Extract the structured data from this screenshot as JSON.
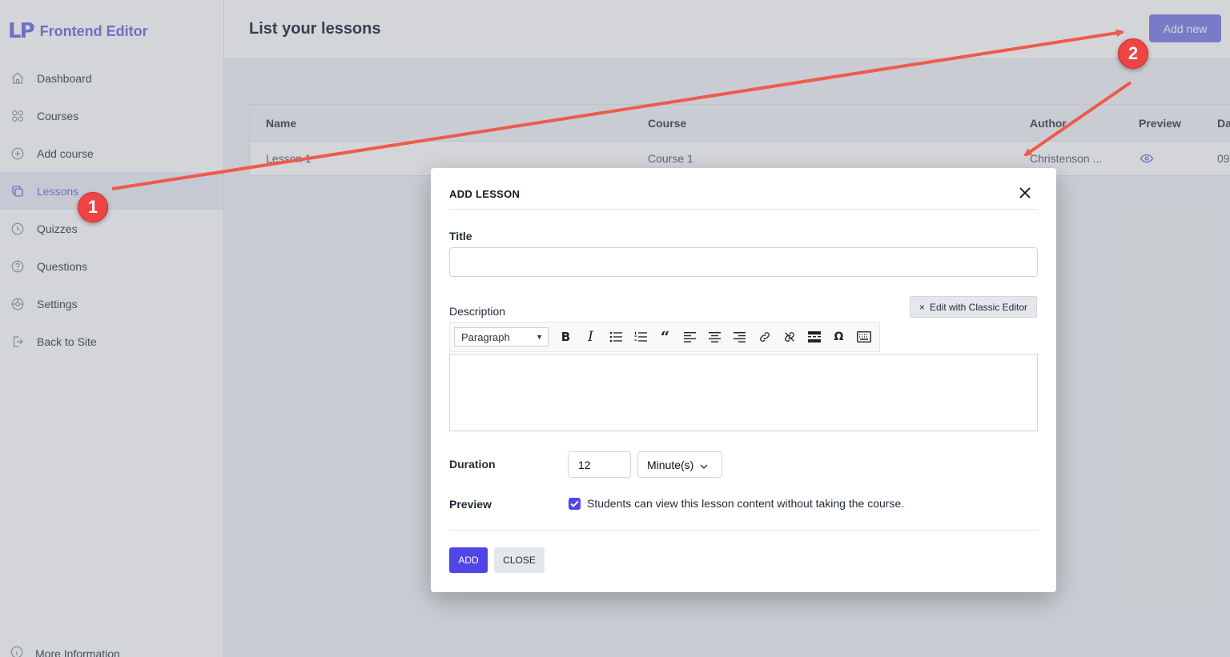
{
  "app": {
    "logo_mark": "LP",
    "logo_text": "Frontend Editor"
  },
  "sidebar": {
    "items": [
      {
        "label": "Dashboard",
        "icon": "home-icon"
      },
      {
        "label": "Courses",
        "icon": "grid-icon"
      },
      {
        "label": "Add course",
        "icon": "plus-circle-icon"
      },
      {
        "label": "Lessons",
        "icon": "copy-icon"
      },
      {
        "label": "Quizzes",
        "icon": "clock-icon"
      },
      {
        "label": "Questions",
        "icon": "question-circle-icon"
      },
      {
        "label": "Settings",
        "icon": "gear-icon"
      },
      {
        "label": "Back to Site",
        "icon": "exit-icon"
      }
    ],
    "more_info": "More Information",
    "active_item": "Lessons"
  },
  "header": {
    "title": "List your lessons",
    "add_new": "Add new"
  },
  "table": {
    "columns": [
      "Name",
      "Course",
      "Author",
      "Preview",
      "Da"
    ],
    "rows": [
      {
        "name": "Lesson 1",
        "course": "Course 1",
        "author": "Christenson ...",
        "preview_icon": "eye-icon",
        "date": "09"
      }
    ]
  },
  "modal": {
    "title": "ADD LESSON",
    "close_icon": "close-icon",
    "title_label": "Title",
    "title_value": "",
    "description_label": "Description",
    "classic_editor": "Edit with Classic Editor",
    "format_select": "Paragraph",
    "toolbar_icons": [
      "bold-icon",
      "italic-icon",
      "bullet-list-icon",
      "numbered-list-icon",
      "blockquote-icon",
      "align-left-icon",
      "align-center-icon",
      "align-right-icon",
      "link-icon",
      "unlink-icon",
      "read-more-icon",
      "special-char-icon",
      "keyboard-icon"
    ],
    "duration_label": "Duration",
    "duration_value": "12",
    "duration_unit": "Minute(s)",
    "preview_label": "Preview",
    "preview_checked": true,
    "preview_text": "Students can view this lesson content without taking the course.",
    "add_button": "ADD",
    "close_button": "CLOSE"
  },
  "annotations": {
    "badge_1": "1",
    "badge_2": "2",
    "arrow_color": "#ef5a4c"
  },
  "colors": {
    "accent": "#7f7ee0",
    "primary": "#4f46e5",
    "add_new_bg": "#8b8ce8"
  }
}
